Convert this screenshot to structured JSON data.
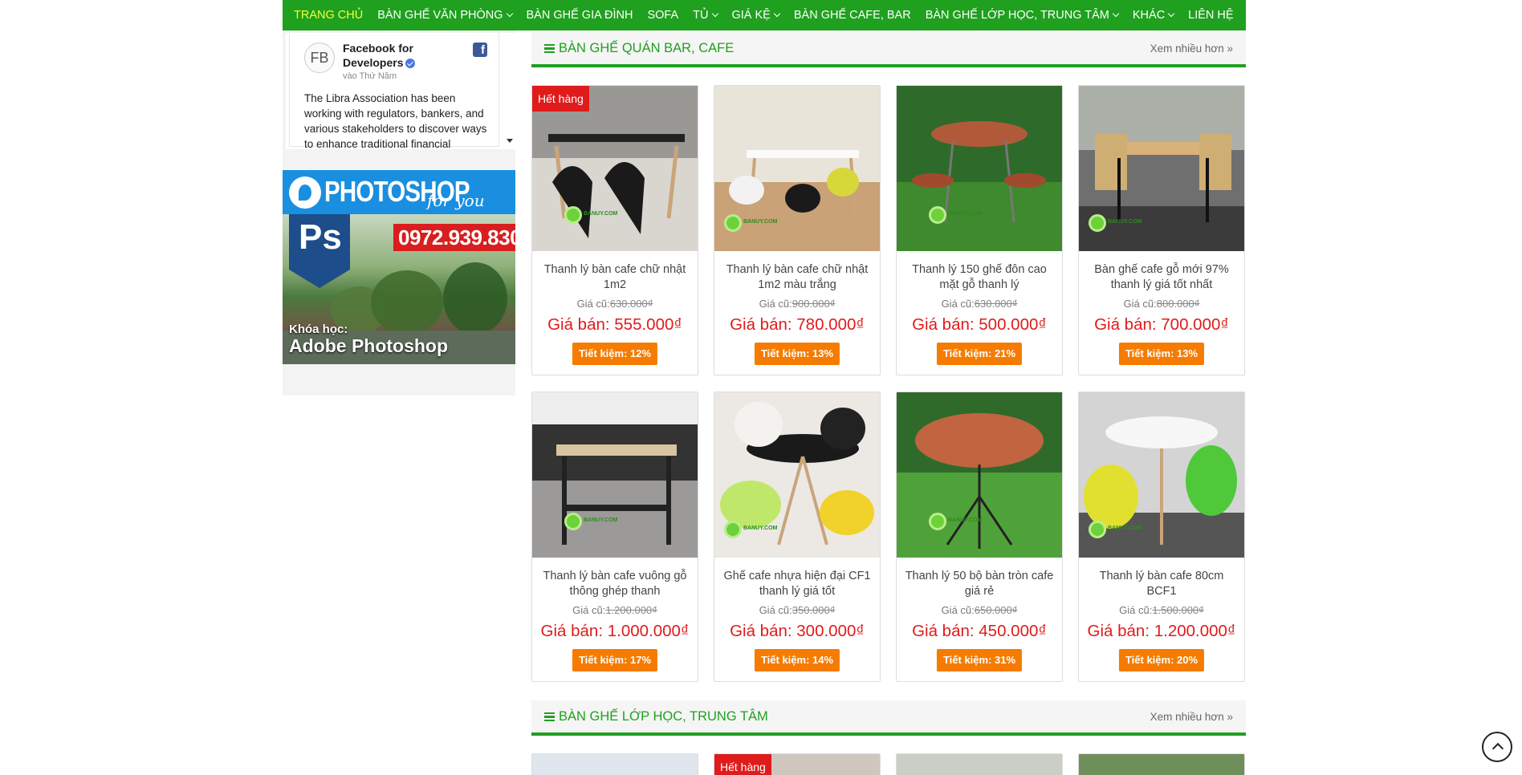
{
  "nav": {
    "items": [
      {
        "label": "TRANG CHỦ"
      },
      {
        "label": "BÀN GHẾ VĂN PHÒNG"
      },
      {
        "label": "BÀN GHẾ GIA ĐÌNH"
      },
      {
        "label": "SOFA"
      },
      {
        "label": "TỦ"
      },
      {
        "label": "GIÁ KỆ"
      },
      {
        "label": "BÀN GHẾ CAFE, BAR"
      },
      {
        "label": "BÀN GHẾ LỚP HỌC, TRUNG TÂM"
      },
      {
        "label": "KHÁC"
      },
      {
        "label": "LIÊN HỆ"
      }
    ]
  },
  "facebook": {
    "avatar": "FB",
    "name": "Facebook for Developers",
    "date": "vào Thứ Năm",
    "text": "The Libra Association has been working with regulators, bankers, and various stakeholders to discover ways to enhance traditional financial"
  },
  "banner": {
    "title": "PHOTOSHOP",
    "for_you": "for you",
    "badge": "Ps",
    "phone": "0972.939.830",
    "course_label": "Khóa học:",
    "course_name": "Adobe Photoshop"
  },
  "section1": {
    "title": "BÀN GHẾ QUÁN BAR, CAFE",
    "more": "Xem nhiều hơn »"
  },
  "section2": {
    "title": "BÀN GHẾ LỚP HỌC, TRUNG TÂM",
    "more": "Xem nhiều hơn »"
  },
  "labels": {
    "out_of_stock": "Hết hàng",
    "old_price_prefix": "Giá cũ:"
  },
  "products": [
    {
      "name": "Thanh lý bàn cafe chữ nhật 1m2",
      "old": "630.000₫",
      "price": "Giá bán: 555.000₫",
      "save": "Tiết kiệm: 12%",
      "out": true
    },
    {
      "name": "Thanh lý bàn cafe chữ nhật 1m2 màu trắng",
      "old": "900.000₫",
      "price": "Giá bán: 780.000₫",
      "save": "Tiết kiệm: 13%",
      "out": false
    },
    {
      "name": "Thanh lý 150 ghế đôn cao mặt gỗ thanh lý",
      "old": "630.000₫",
      "price": "Giá bán: 500.000₫",
      "save": "Tiết kiệm: 21%",
      "out": false
    },
    {
      "name": "Bàn ghế cafe gỗ mới 97% thanh lý giá tốt nhất",
      "old": "800.000₫",
      "price": "Giá bán: 700.000₫",
      "save": "Tiết kiệm: 13%",
      "out": false
    },
    {
      "name": "Thanh lý bàn cafe vuông gỗ thông ghép thanh",
      "old": "1.200.000₫",
      "price": "Giá bán: 1.000.000₫",
      "save": "Tiết kiệm: 17%",
      "out": false
    },
    {
      "name": "Ghế cafe nhựa hiện đại CF1 thanh lý giá tốt",
      "old": "350.000₫",
      "price": "Giá bán: 300.000₫",
      "save": "Tiết kiệm: 14%",
      "out": false
    },
    {
      "name": "Thanh lý 50 bộ bàn tròn cafe giá rẻ",
      "old": "650.000₫",
      "price": "Giá bán: 450.000₫",
      "save": "Tiết kiệm: 31%",
      "out": false
    },
    {
      "name": "Thanh lý bàn cafe 80cm BCF1",
      "old": "1.500.000₫",
      "price": "Giá bán: 1.200.000₫",
      "save": "Tiết kiệm: 20%",
      "out": false
    }
  ],
  "watermark": "BANUY.COM",
  "colors": {
    "brand_green": "#1fa01f",
    "active_nav": "#f5ff3a",
    "price_red": "#e01b1b",
    "save_orange": "#f57c00"
  }
}
